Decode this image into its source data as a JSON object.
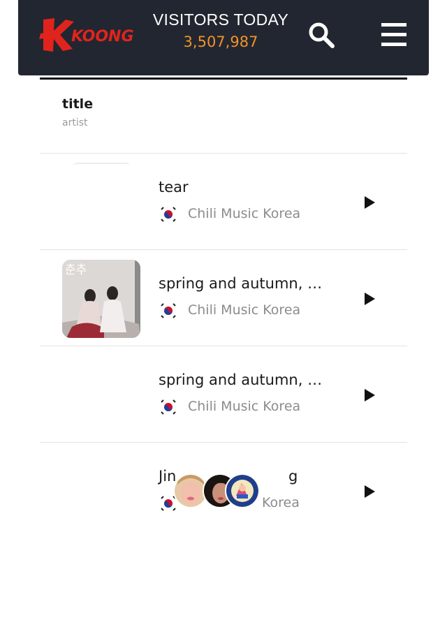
{
  "header": {
    "logo_text": "KOONG",
    "visitors_label": "VISITORS TODAY",
    "visitors_count": "3,507,987",
    "icons": [
      "search-icon",
      "menu-icon"
    ]
  },
  "columns": {
    "title": "title",
    "artist": "artist"
  },
  "rows": [
    {
      "title": "tear",
      "artist": "Chili Music Korea",
      "flag": "south-korea-flag-icon",
      "has_thumb": false
    },
    {
      "title": "spring and autumn, …",
      "artist": "Chili Music Korea",
      "flag": "south-korea-flag-icon",
      "has_thumb": true,
      "thumb_text": "춘추"
    },
    {
      "title": "spring and autumn, …",
      "artist": "Chili Music Korea",
      "flag": "south-korea-flag-icon",
      "has_thumb": false
    },
    {
      "title": "Jin",
      "title_tail": "g",
      "artist": "Korea",
      "flag": "south-korea-flag-icon",
      "has_thumb": false
    }
  ],
  "colors": {
    "header_bg": "#222630",
    "accent": "#f0922b",
    "logo": "#e0241d"
  }
}
